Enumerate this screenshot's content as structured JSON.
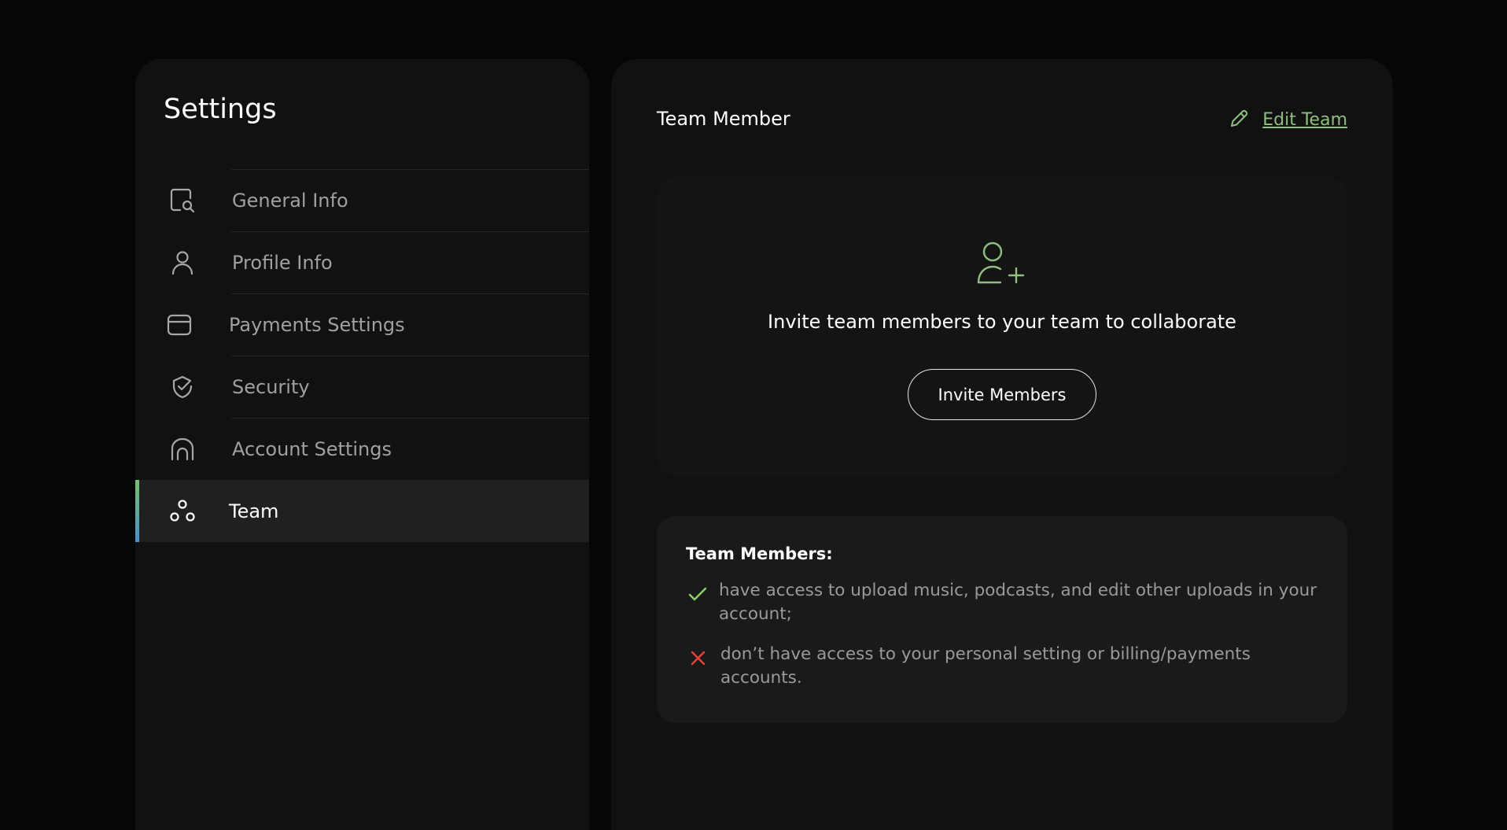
{
  "sidebar": {
    "title": "Settings",
    "items": [
      {
        "label": "General Info",
        "icon": "search-document-icon",
        "active": false
      },
      {
        "label": "Profile Info",
        "icon": "user-icon",
        "active": false
      },
      {
        "label": "Payments Settings",
        "icon": "card-icon",
        "active": false
      },
      {
        "label": "Security",
        "icon": "shield-check-icon",
        "active": false
      },
      {
        "label": "Account Settings",
        "icon": "home-icon",
        "active": false
      },
      {
        "label": "Team",
        "icon": "team-icon",
        "active": true
      }
    ]
  },
  "main": {
    "title": "Team Member",
    "edit_team_label": "Edit Team",
    "invite": {
      "text": "Invite team members to your team to collaborate",
      "button_label": "Invite Members"
    },
    "members": {
      "title": "Team Members:",
      "allowed": "have access to upload music, podcasts, and edit other uploads in your account;",
      "denied": "don’t have access to your personal setting or billing/payments accounts."
    }
  },
  "colors": {
    "background": "#060606",
    "panel": "#111111",
    "accent_green": "#8fbf7f",
    "check_green": "#8fd06e",
    "deny_red": "#e2463a",
    "active_bar_top": "#7bbf6d",
    "active_bar_bottom": "#4a90c8"
  }
}
